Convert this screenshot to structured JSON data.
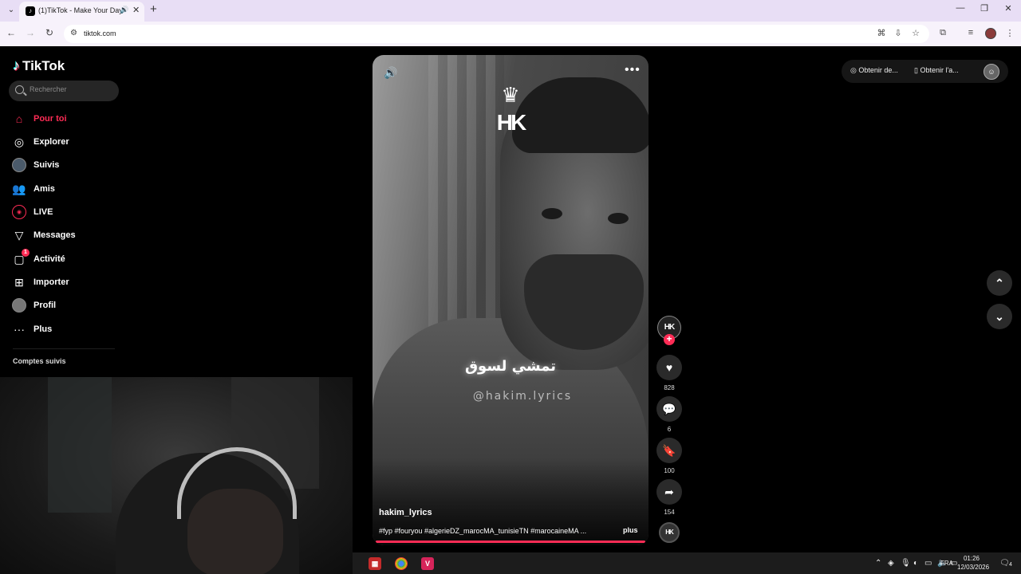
{
  "browser": {
    "tab_title": "(1)TikTok - Make Your Day",
    "url": "tiktok.com"
  },
  "sidebar": {
    "logo_text": "TikTok",
    "search_placeholder": "Rechercher",
    "items": [
      {
        "label": "Pour toi",
        "icon": "home-icon",
        "active": true
      },
      {
        "label": "Explorer",
        "icon": "compass-icon"
      },
      {
        "label": "Suivis",
        "icon": "avatar"
      },
      {
        "label": "Amis",
        "icon": "friends-icon"
      },
      {
        "label": "LIVE",
        "icon": "live-icon"
      },
      {
        "label": "Messages",
        "icon": "send-icon"
      },
      {
        "label": "Activité",
        "icon": "activity-icon",
        "badge": "1"
      },
      {
        "label": "Importer",
        "icon": "upload-icon"
      },
      {
        "label": "Profil",
        "icon": "profile-avatar"
      },
      {
        "label": "Plus",
        "icon": "more-icon"
      }
    ],
    "followed_heading": "Comptes suivis"
  },
  "video": {
    "caption": "تمشي لسوق",
    "watermark": "@hakim.lyrics",
    "author": "hakim_lyrics",
    "hashtags": "#fyp #fouryou #algerieDZ_marocMA_tunisieTN #marocaineMA ...",
    "more_label": "plus",
    "brand_mark": "HK"
  },
  "actions": {
    "likes": "828",
    "comments": "6",
    "saves": "100",
    "shares": "154"
  },
  "topright": {
    "get_coins": "Obtenir de...",
    "get_app": "Obtenir l'a..."
  },
  "taskbar": {
    "language": "FRA",
    "time": "01:26",
    "date": "12/03/2026",
    "notifications": "4"
  },
  "colors": {
    "accent": "#fe2c55",
    "background": "#000000"
  }
}
